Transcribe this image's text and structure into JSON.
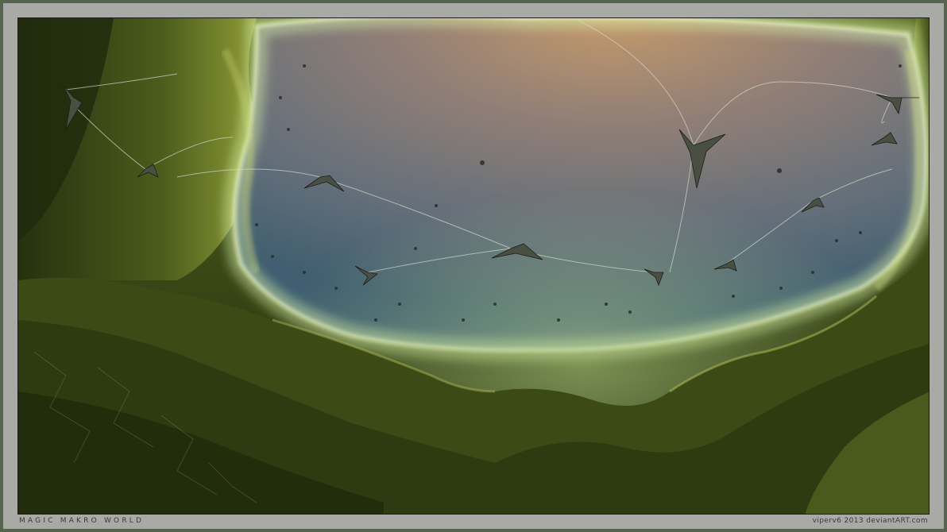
{
  "artwork": {
    "title": "MAGIC MAKRO WORLD",
    "credit": "viperv6 2013 deviantART.com"
  },
  "colors": {
    "outer_frame": "#56644e",
    "mat": "#a9aaa6",
    "sky_top": "#b89870",
    "sky_mid": "#8f7f78",
    "sky_bottom": "#53697a",
    "glow": "#d6f0a0",
    "moss_dark": "#243010",
    "moss_light": "#a8b048"
  }
}
